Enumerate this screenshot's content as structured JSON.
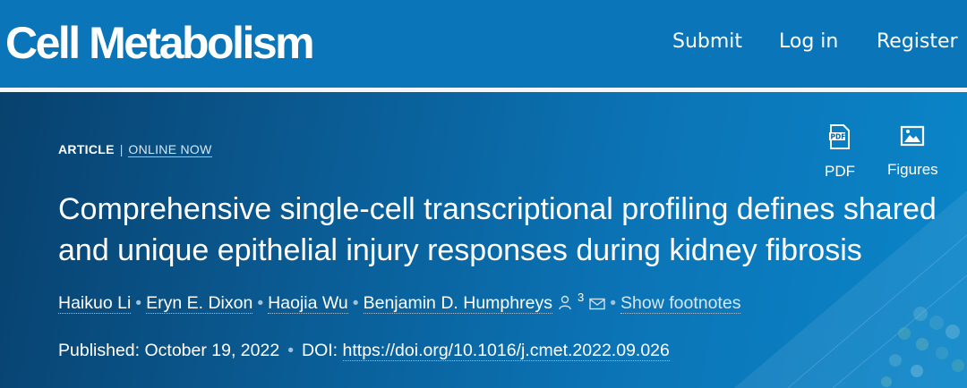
{
  "header": {
    "brand": "Cell Metabolism",
    "nav": [
      {
        "label": "Submit"
      },
      {
        "label": "Log in"
      },
      {
        "label": "Register"
      }
    ]
  },
  "article": {
    "type": "ARTICLE",
    "separator": "|",
    "status": "ONLINE NOW",
    "tools": [
      {
        "label": "PDF",
        "icon": "pdf-icon"
      },
      {
        "label": "Figures",
        "icon": "figures-icon"
      }
    ],
    "title": "Comprehensive single-cell transcriptional profiling defines shared and unique epithelial injury responses during kidney fibrosis",
    "authors": [
      {
        "name": "Haikuo Li"
      },
      {
        "name": "Eryn E. Dixon"
      },
      {
        "name": "Haojia Wu"
      },
      {
        "name": "Benjamin D. Humphreys"
      }
    ],
    "author_count_superscript": "3",
    "show_footnotes": "Show footnotes",
    "published_label": "Published:",
    "published_date": "October 19, 2022",
    "doi_label": "DOI:",
    "doi_link": "https://doi.org/10.1016/j.cmet.2022.09.026"
  },
  "colors": {
    "header_bg": "#0a76b9",
    "hero_dark": "#08416e",
    "hero_light": "#0a86c9",
    "text": "#ffffff"
  }
}
